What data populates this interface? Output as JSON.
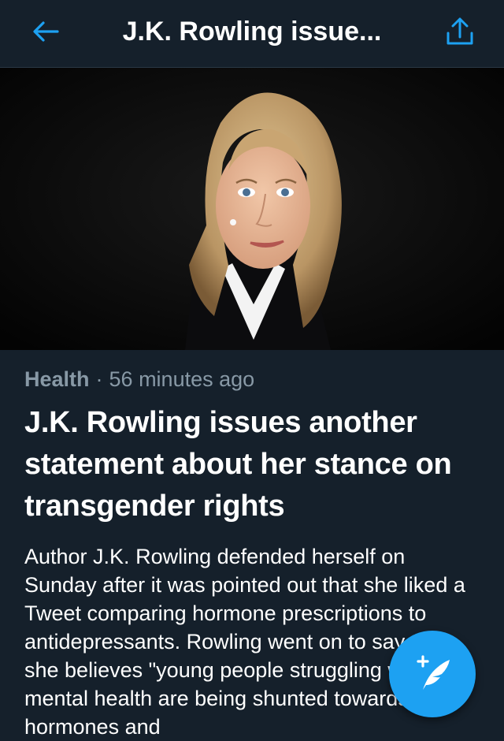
{
  "header": {
    "title": "J.K. Rowling issue...",
    "back_icon": "arrow-left-icon",
    "share_icon": "share-icon"
  },
  "hero": {
    "image_icon": "portrait-photo"
  },
  "article": {
    "category": "Health",
    "separator": "·",
    "time": "56 minutes ago",
    "headline": "J.K. Rowling issues another statement about her stance on transgender rights",
    "body": "Author J.K. Rowling defended herself on Sunday after it was pointed out that she liked a Tweet comparing hormone prescriptions to antidepressants. Rowling went on to say that she believes \"young people struggling with their mental health are being shunted towards hormones and"
  },
  "fab": {
    "icon": "compose-tweet-icon"
  },
  "colors": {
    "background": "#15202b",
    "accent": "#1da1f2",
    "muted": "#8899a6"
  }
}
